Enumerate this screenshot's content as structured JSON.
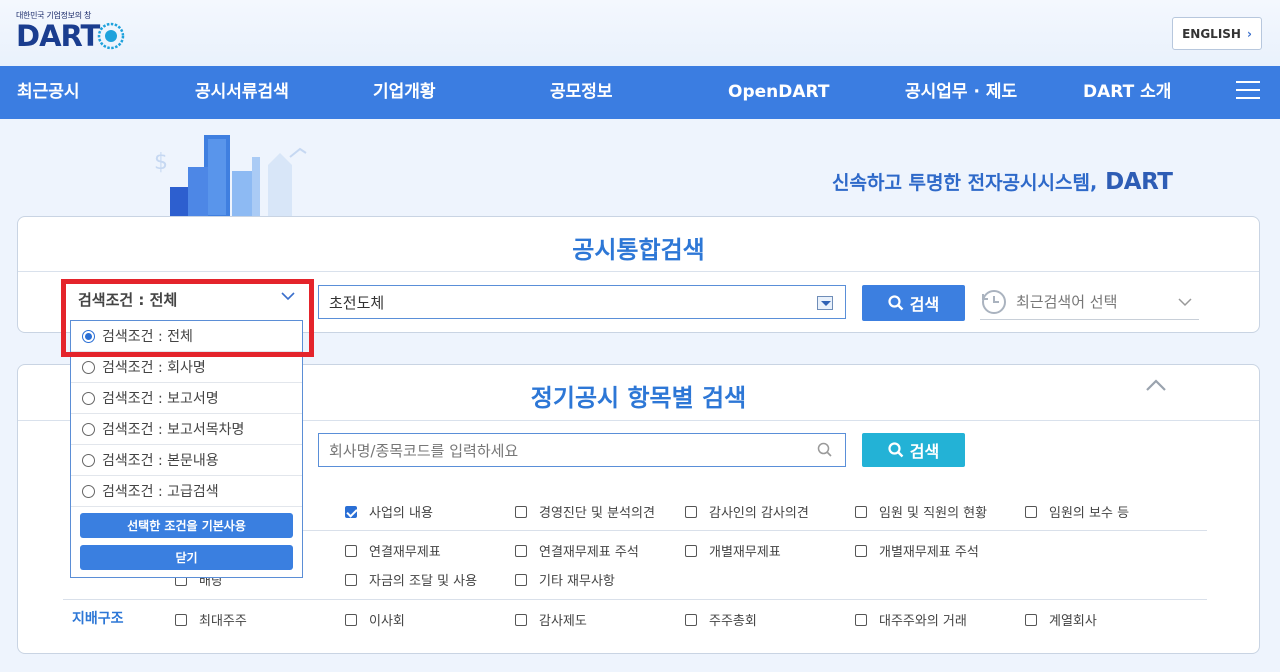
{
  "header": {
    "logo_tagline": "대한민국 기업정보의 창",
    "logo_text": "DART",
    "english_label": "ENGLISH"
  },
  "nav": {
    "items": [
      "최근공시",
      "공시서류검색",
      "기업개황",
      "공모정보",
      "OpenDART",
      "공시업무 · 제도",
      "DART 소개"
    ]
  },
  "hero": {
    "slogan": "신속하고 투명한 전자공시시스템,",
    "slogan_brand": "DART"
  },
  "integrated_search": {
    "title": "공시통합검색",
    "condition_selected": "검색조건 : 전체",
    "query_value": "초전도체",
    "search_label": "검색",
    "recent_placeholder": "최근검색어 선택",
    "condition_options": [
      {
        "label": "검색조건 : 전체",
        "selected": true
      },
      {
        "label": "검색조건 : 회사명",
        "selected": false
      },
      {
        "label": "검색조건 : 보고서명",
        "selected": false
      },
      {
        "label": "검색조건 : 보고서목차명",
        "selected": false
      },
      {
        "label": "검색조건 : 본문내용",
        "selected": false
      },
      {
        "label": "검색조건 : 고급검색",
        "selected": false
      }
    ],
    "set_default_label": "선택한 조건을 기본사용",
    "close_label": "닫기"
  },
  "periodic_search": {
    "title": "정기공시 항목별 검색",
    "company_placeholder": "회사명/종목코드를 입력하세요",
    "search_label": "검색",
    "row1": [
      {
        "label": "사업의 내용",
        "checked": true
      },
      {
        "label": "경영진단 및 분석의견",
        "checked": false
      },
      {
        "label": "감사인의 감사의견",
        "checked": false
      },
      {
        "label": "임원 및 직원의 현황",
        "checked": false
      },
      {
        "label": "임원의 보수 등",
        "checked": false
      }
    ],
    "row2": [
      {
        "label": "연결재무제표",
        "checked": false
      },
      {
        "label": "연결재무제표 주석",
        "checked": false
      },
      {
        "label": "개별재무제표",
        "checked": false
      },
      {
        "label": "개별재무제표 주석",
        "checked": false
      }
    ],
    "row3_hidden_label": "배당",
    "row3": [
      {
        "label": "자금의 조달 및 사용",
        "checked": false
      },
      {
        "label": "기타 재무사항",
        "checked": false
      }
    ],
    "governance_label": "지배구조",
    "row4": [
      {
        "label": "최대주주",
        "checked": false
      },
      {
        "label": "이사회",
        "checked": false
      },
      {
        "label": "감사제도",
        "checked": false
      },
      {
        "label": "주주총회",
        "checked": false
      },
      {
        "label": "대주주와의 거래",
        "checked": false
      },
      {
        "label": "계열회사",
        "checked": false
      }
    ]
  },
  "colors": {
    "nav_bg": "#3b7de1",
    "accent": "#2d77d6",
    "teal": "#23b2d6",
    "highlight_red": "#e4242b"
  }
}
